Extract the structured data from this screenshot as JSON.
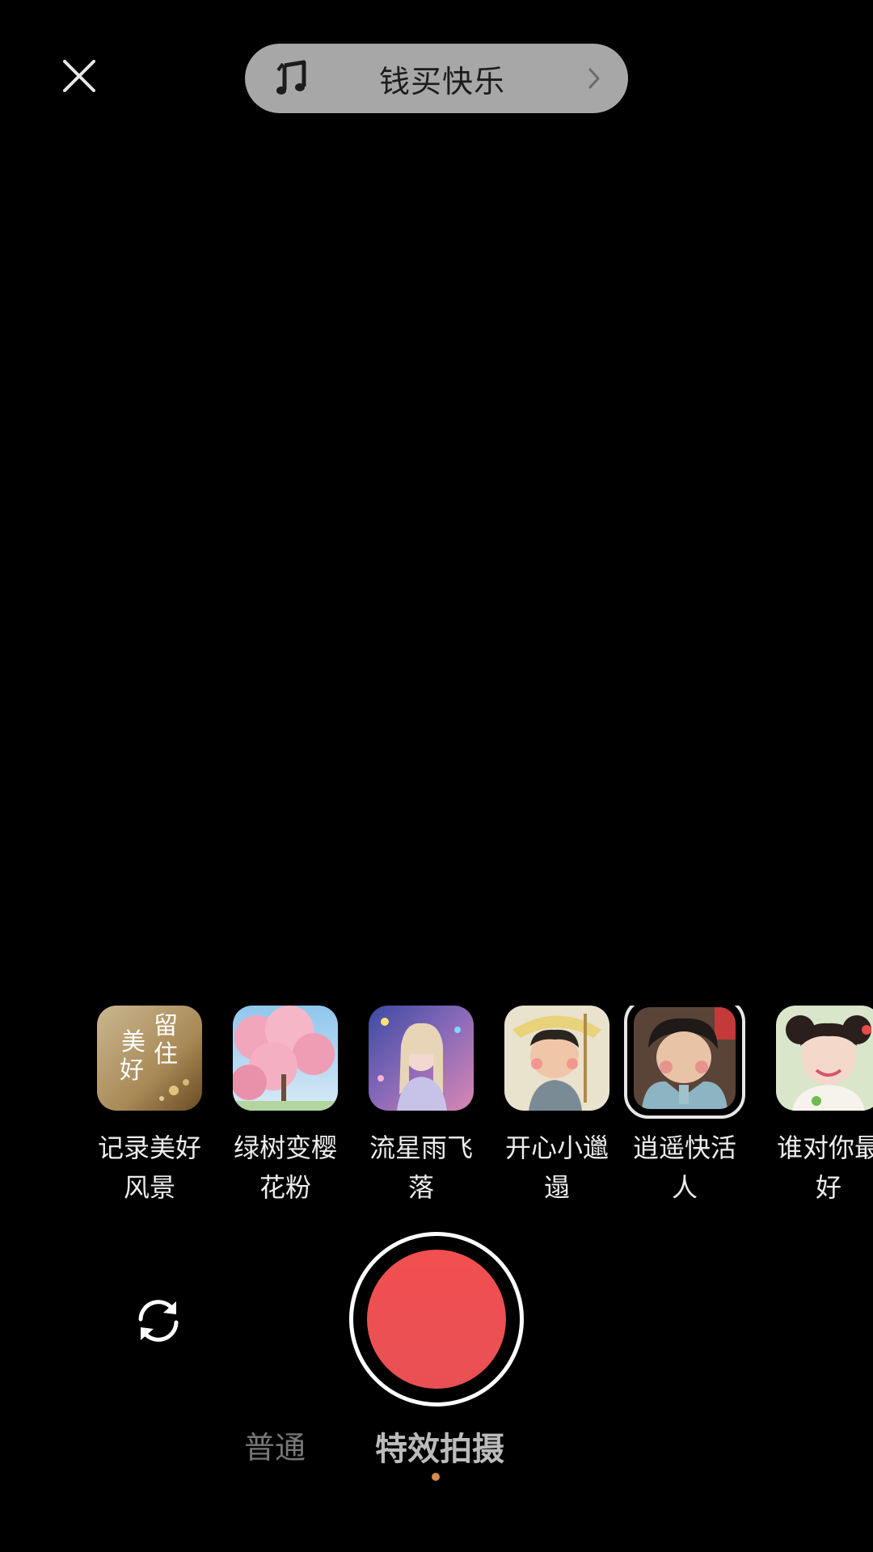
{
  "top_bar": {
    "close_icon": "close-icon",
    "music": {
      "icon": "music-note-icon",
      "song_title": "钱买快乐",
      "chevron_icon": "chevron-right-icon"
    }
  },
  "effects": [
    {
      "name": "记录美好风景",
      "line1": "记录美好",
      "line2": "风景",
      "thumb_text": "美 留\n好 住",
      "selected": false,
      "colors": [
        "#c8b28a",
        "#8a6a3e"
      ]
    },
    {
      "name": "绿树变樱花粉",
      "line1": "绿树变樱",
      "line2": "花粉",
      "selected": false,
      "colors": [
        "#f3b9c8",
        "#8fc7ef"
      ]
    },
    {
      "name": "流星雨飞落",
      "line1": "流星雨飞",
      "line2": "落",
      "selected": false,
      "colors": [
        "#5a6db8",
        "#d987b3"
      ]
    },
    {
      "name": "开心小邋遢",
      "line1": "开心小邋",
      "line2": "遢",
      "selected": false,
      "colors": [
        "#e7dfc7",
        "#8f8a6b"
      ]
    },
    {
      "name": "逍遥快活人",
      "line1": "逍遥快活",
      "line2": "人",
      "selected": true,
      "colors": [
        "#4d3c33",
        "#8fb7c4"
      ]
    },
    {
      "name": "谁对你最好",
      "line1": "谁对你最",
      "line2": "好",
      "selected": false,
      "colors": [
        "#f2e2d6",
        "#9ac36c"
      ]
    }
  ],
  "controls": {
    "flip_camera_icon": "flip-camera-icon",
    "shutter_color": "#f04e50"
  },
  "modes": {
    "normal_label": "普通",
    "effect_label": "特效拍摄",
    "active": "特效拍摄",
    "indicator_color": "#d48a4a"
  }
}
